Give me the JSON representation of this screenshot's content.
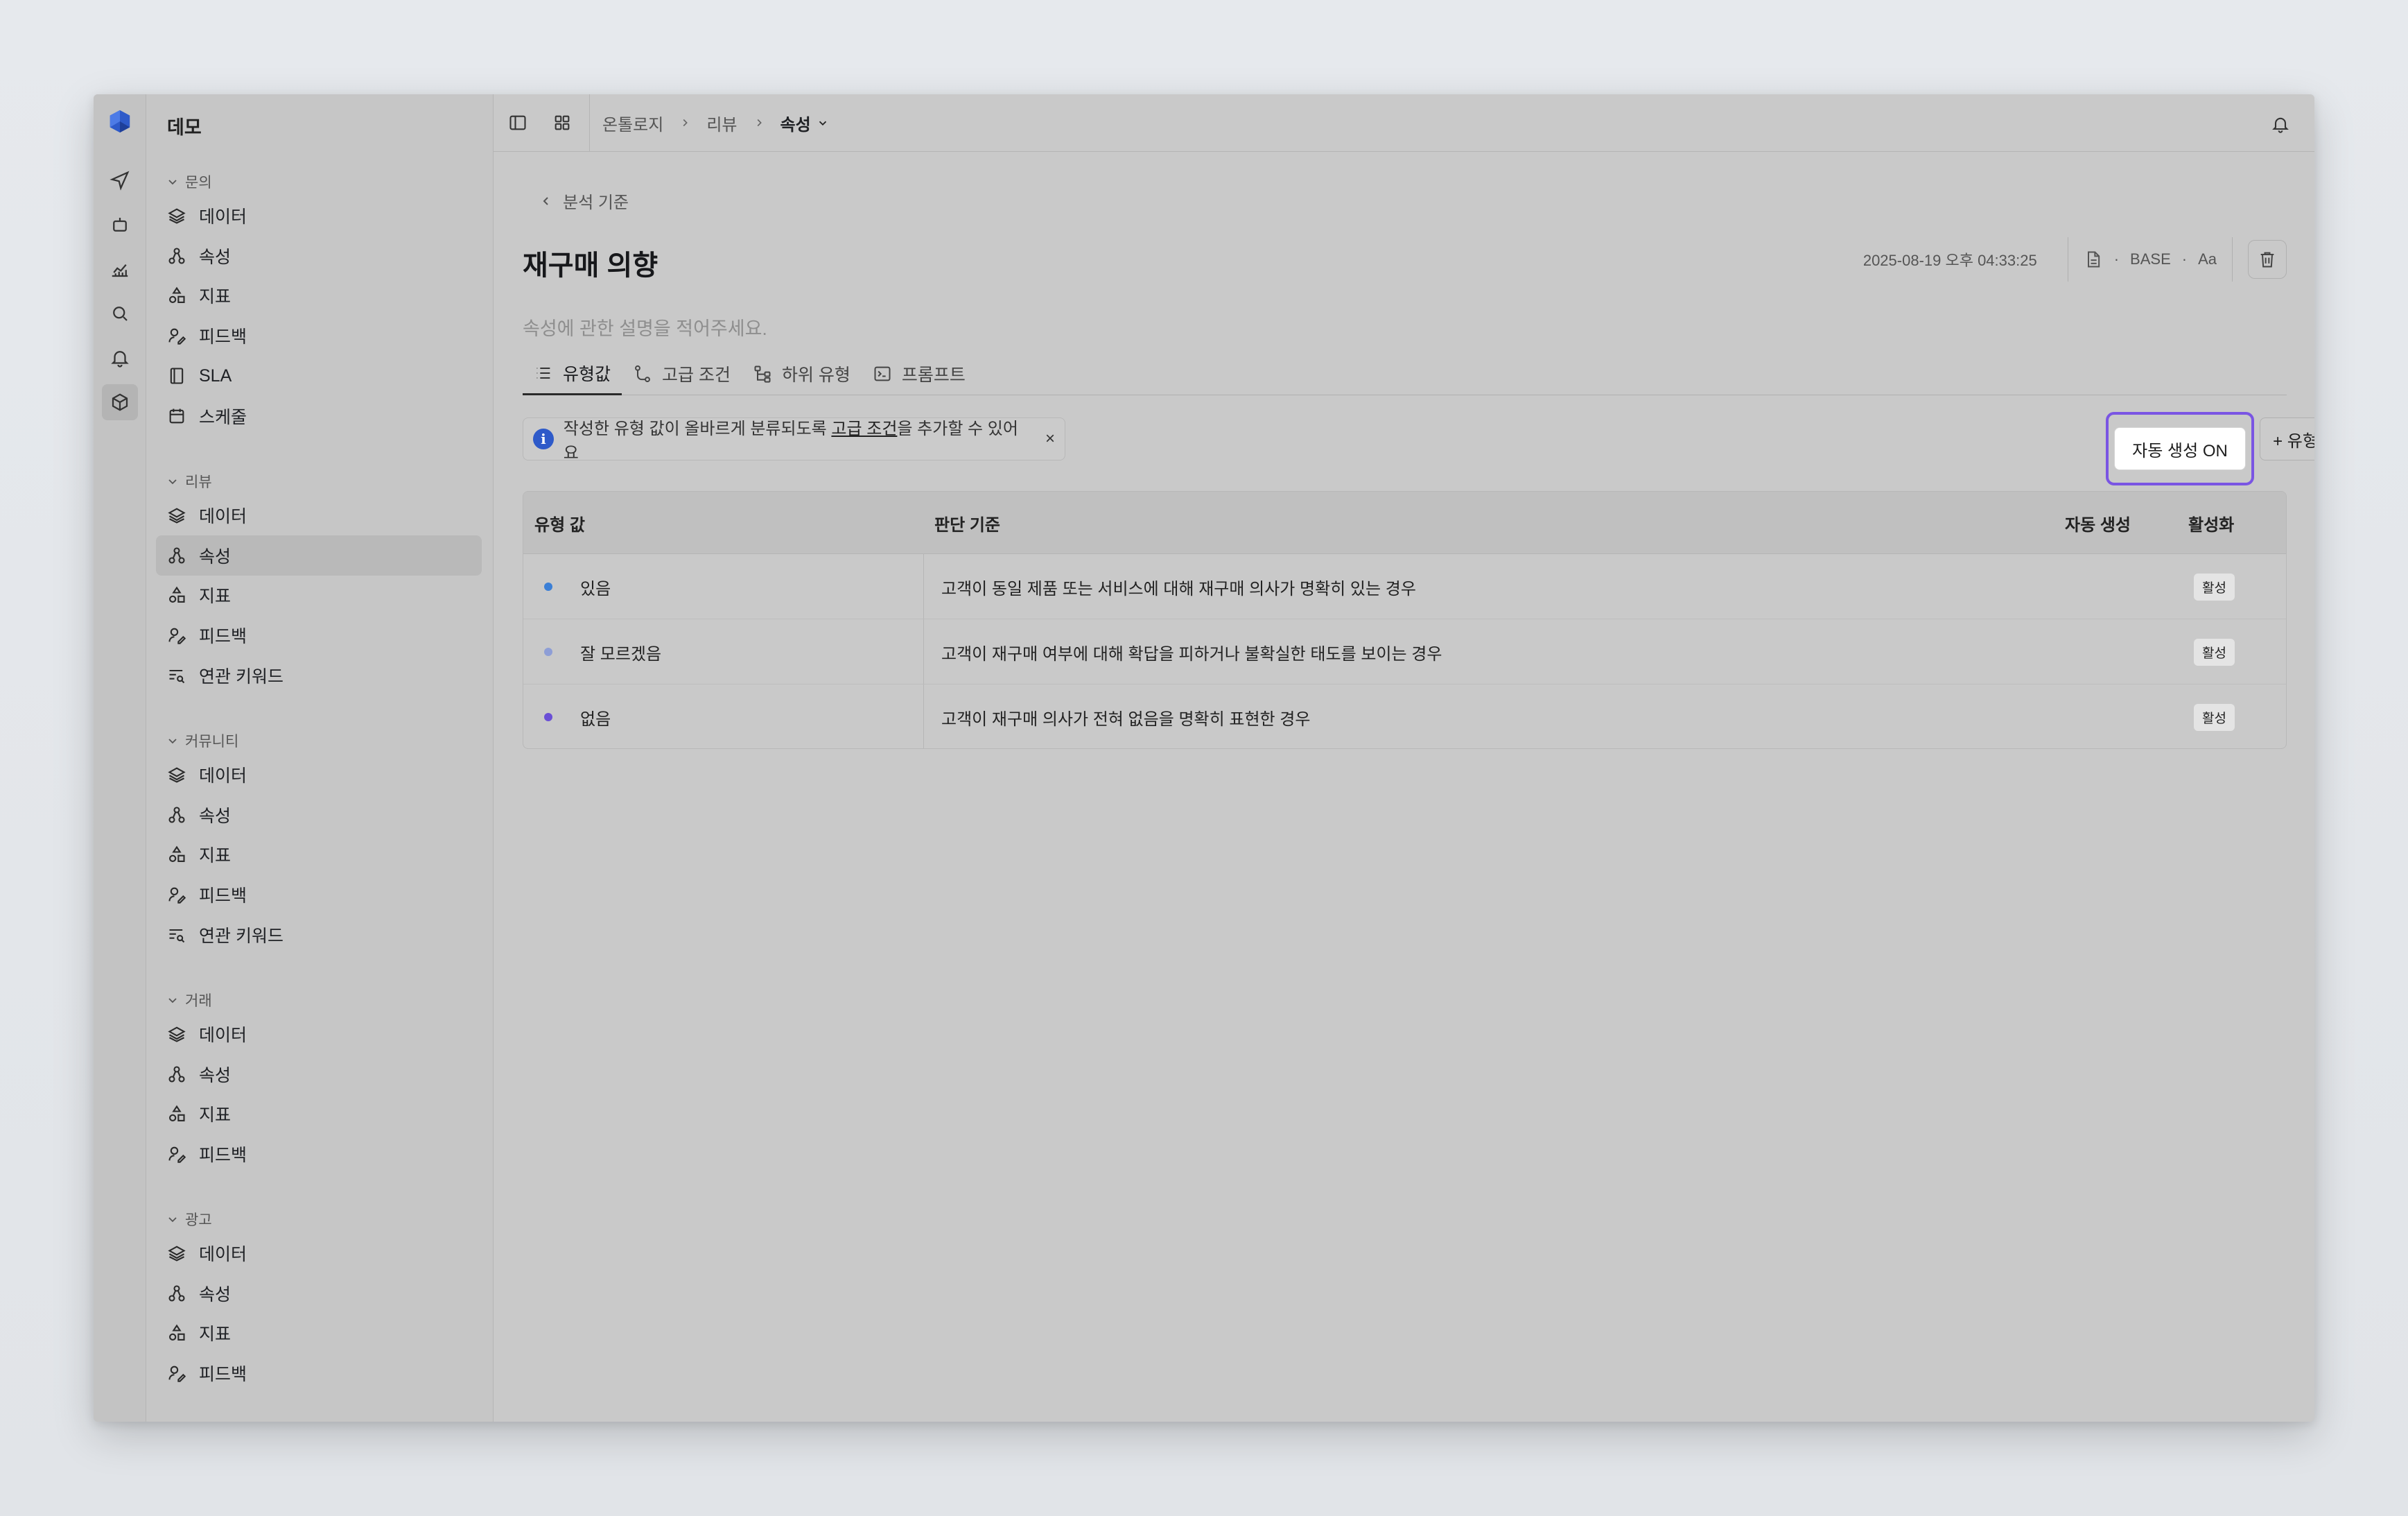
{
  "sidebar": {
    "title": "데모",
    "groups": [
      {
        "label": "문의",
        "items": [
          "데이터",
          "속성",
          "지표",
          "피드백",
          "SLA",
          "스케줄"
        ]
      },
      {
        "label": "리뷰",
        "items": [
          "데이터",
          "속성",
          "지표",
          "피드백",
          "연관 키워드"
        ]
      },
      {
        "label": "커뮤니티",
        "items": [
          "데이터",
          "속성",
          "지표",
          "피드백",
          "연관 키워드"
        ]
      },
      {
        "label": "거래",
        "items": [
          "데이터",
          "속성",
          "지표",
          "피드백"
        ]
      },
      {
        "label": "광고",
        "items": [
          "데이터",
          "속성",
          "지표",
          "피드백"
        ]
      }
    ]
  },
  "breadcrumb": {
    "c1": "온톨로지",
    "c2": "리뷰",
    "c3": "속성"
  },
  "page": {
    "back_label": "분석 기준",
    "title": "재구매 의향",
    "timestamp": "2025-08-19 오후 04:33:25",
    "base_label": "BASE",
    "font_label": "Aa",
    "description_placeholder": "속성에 관한 설명을 적어주세요."
  },
  "tabs": [
    "유형값",
    "고급 조건",
    "하위 유형",
    "프롬프트"
  ],
  "info": {
    "prefix": "작성한 유형 값이 올바르게 분류되도록 ",
    "link": "고급 조건",
    "suffix": "을 추가할 수 있어요",
    "close": "×"
  },
  "actions": {
    "auto_generate": "자동 생성 ON",
    "add_value": "+ 유형값 추가"
  },
  "table": {
    "headers": {
      "value": "유형 값",
      "criteria": "판단 기준",
      "auto": "자동 생성",
      "active": "활성화"
    },
    "rows": [
      {
        "value": "있음",
        "criteria": "고객이 동일 제품 또는 서비스에 대해 재구매 의사가 명확히 있는 경우",
        "status": "활성",
        "dot": "#3b7fd6"
      },
      {
        "value": "잘 모르겠음",
        "criteria": "고객이 재구매 여부에 대해 확답을 피하거나 불확실한 태도를 보이는 경우",
        "status": "활성",
        "dot": "#8e9ed6"
      },
      {
        "value": "없음",
        "criteria": "고객이 재구매 의사가 전혀 없음을 명확히 표현한 경우",
        "status": "활성",
        "dot": "#6a4fd6"
      }
    ]
  },
  "colors": {
    "accent": "#7a55e3",
    "brand": "#2e5ac9"
  }
}
